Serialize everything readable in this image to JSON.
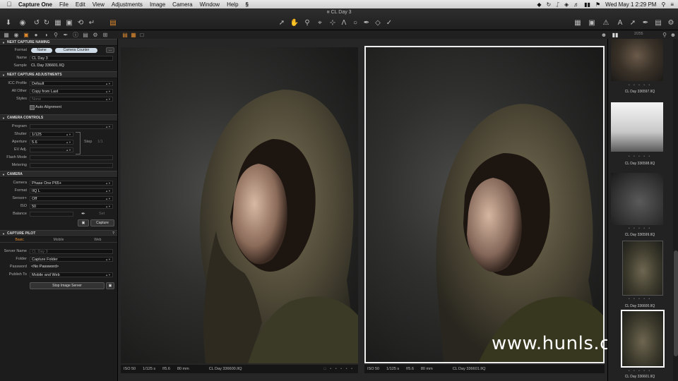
{
  "menubar": {
    "app_name": "Capture One",
    "items": [
      "File",
      "Edit",
      "View",
      "Adjustments",
      "Image",
      "Camera",
      "Window",
      "Help"
    ],
    "clock": "Wed May 1  2:29 PM"
  },
  "window": {
    "title": "CL Day 3"
  },
  "toolbar_left_icons": [
    "import-icon",
    "capture-icon",
    "undo-icon",
    "redo-icon",
    "folder-icon",
    "camera-icon",
    "reset-icon",
    "info-icon",
    "stack-icon"
  ],
  "toolbar_center_icons": [
    "pointer-icon",
    "pan-icon",
    "zoom-icon",
    "crop-icon",
    "straighten-icon",
    "keystone-icon",
    "spot-icon",
    "brush-icon",
    "eraser-icon",
    "gradient-icon",
    "picker-icon"
  ],
  "toolbar_right_icons": [
    "grid-icon",
    "warning-icon",
    "text-icon",
    "color-icon",
    "edit-icon",
    "share-icon"
  ],
  "next_capture_naming": {
    "header": "Next Capture Naming",
    "format_label": "Format",
    "format_tokens": [
      "Name",
      "Camera Counter"
    ],
    "name_label": "Name",
    "name_value": "CL Day 3",
    "sample_label": "Sample",
    "sample_value": "CL Day 336601.IIQ"
  },
  "next_capture_adjustments": {
    "header": "Next Capture Adjustments",
    "icc_label": "ICC Profile",
    "icc_value": "Default",
    "allother_label": "All Other",
    "allother_value": "Copy from Last",
    "styles_label": "Styles",
    "styles_value": "None",
    "auto_alignment": "Auto Alignment"
  },
  "camera_controls": {
    "header": "Camera Controls",
    "program_label": "Program",
    "shutter_label": "Shutter",
    "shutter_value": "1/125",
    "aperture_label": "Aperture",
    "aperture_value": "5.6",
    "step_label": "Step",
    "step_value": "1/1",
    "ev_label": "EV Adj.",
    "flash_label": "Flash Mode",
    "metering_label": "Metering"
  },
  "camera": {
    "header": "Camera",
    "camera_label": "Camera",
    "camera_value": "Phase One P65+",
    "format_label": "Format",
    "format_value": "IIQ L",
    "sensor_label": "Sensor+",
    "sensor_value": "Off",
    "iso_label": "ISO",
    "iso_value": "50",
    "balance_label": "Balance",
    "set_label": "Set",
    "capture_button": "Capture"
  },
  "capture_pilot": {
    "header": "Capture Pilot",
    "tabs": [
      "Basic",
      "Mobile",
      "Web"
    ],
    "server_name_label": "Server Name",
    "server_name_value": "CL Day 3",
    "folder_label": "Folder",
    "folder_value": "Capture Folder",
    "password_label": "Password",
    "password_value": "<No Password>",
    "publish_label": "Publish To",
    "publish_value": "Mobile and Web",
    "stop_button": "Stop Image Server"
  },
  "viewer": {
    "left": {
      "iso": "ISO 50",
      "shutter": "1/125 s",
      "aperture": "f/5.6",
      "focal": "80 mm",
      "filename": "CL Day 336600.IIQ"
    },
    "right": {
      "iso": "ISO 50",
      "shutter": "1/125 s",
      "aperture": "f/5.6",
      "focal": "80 mm",
      "filename": "CL Day 336601.IIQ"
    }
  },
  "filmstrip": {
    "count_label": "2/255",
    "thumbs": [
      {
        "caption": "CL Day 336597.IIQ"
      },
      {
        "caption": "CL Day 336598.IIQ"
      },
      {
        "caption": "CL Day 336599.IIQ"
      },
      {
        "caption": "CL Day 336600.IIQ"
      },
      {
        "caption": "CL Day 336601.IIQ"
      }
    ]
  },
  "watermark": "www.hunls.com",
  "colors": {
    "accent": "#e08a2e",
    "panel": "#1c1c1c",
    "selection": "#ffffff"
  }
}
